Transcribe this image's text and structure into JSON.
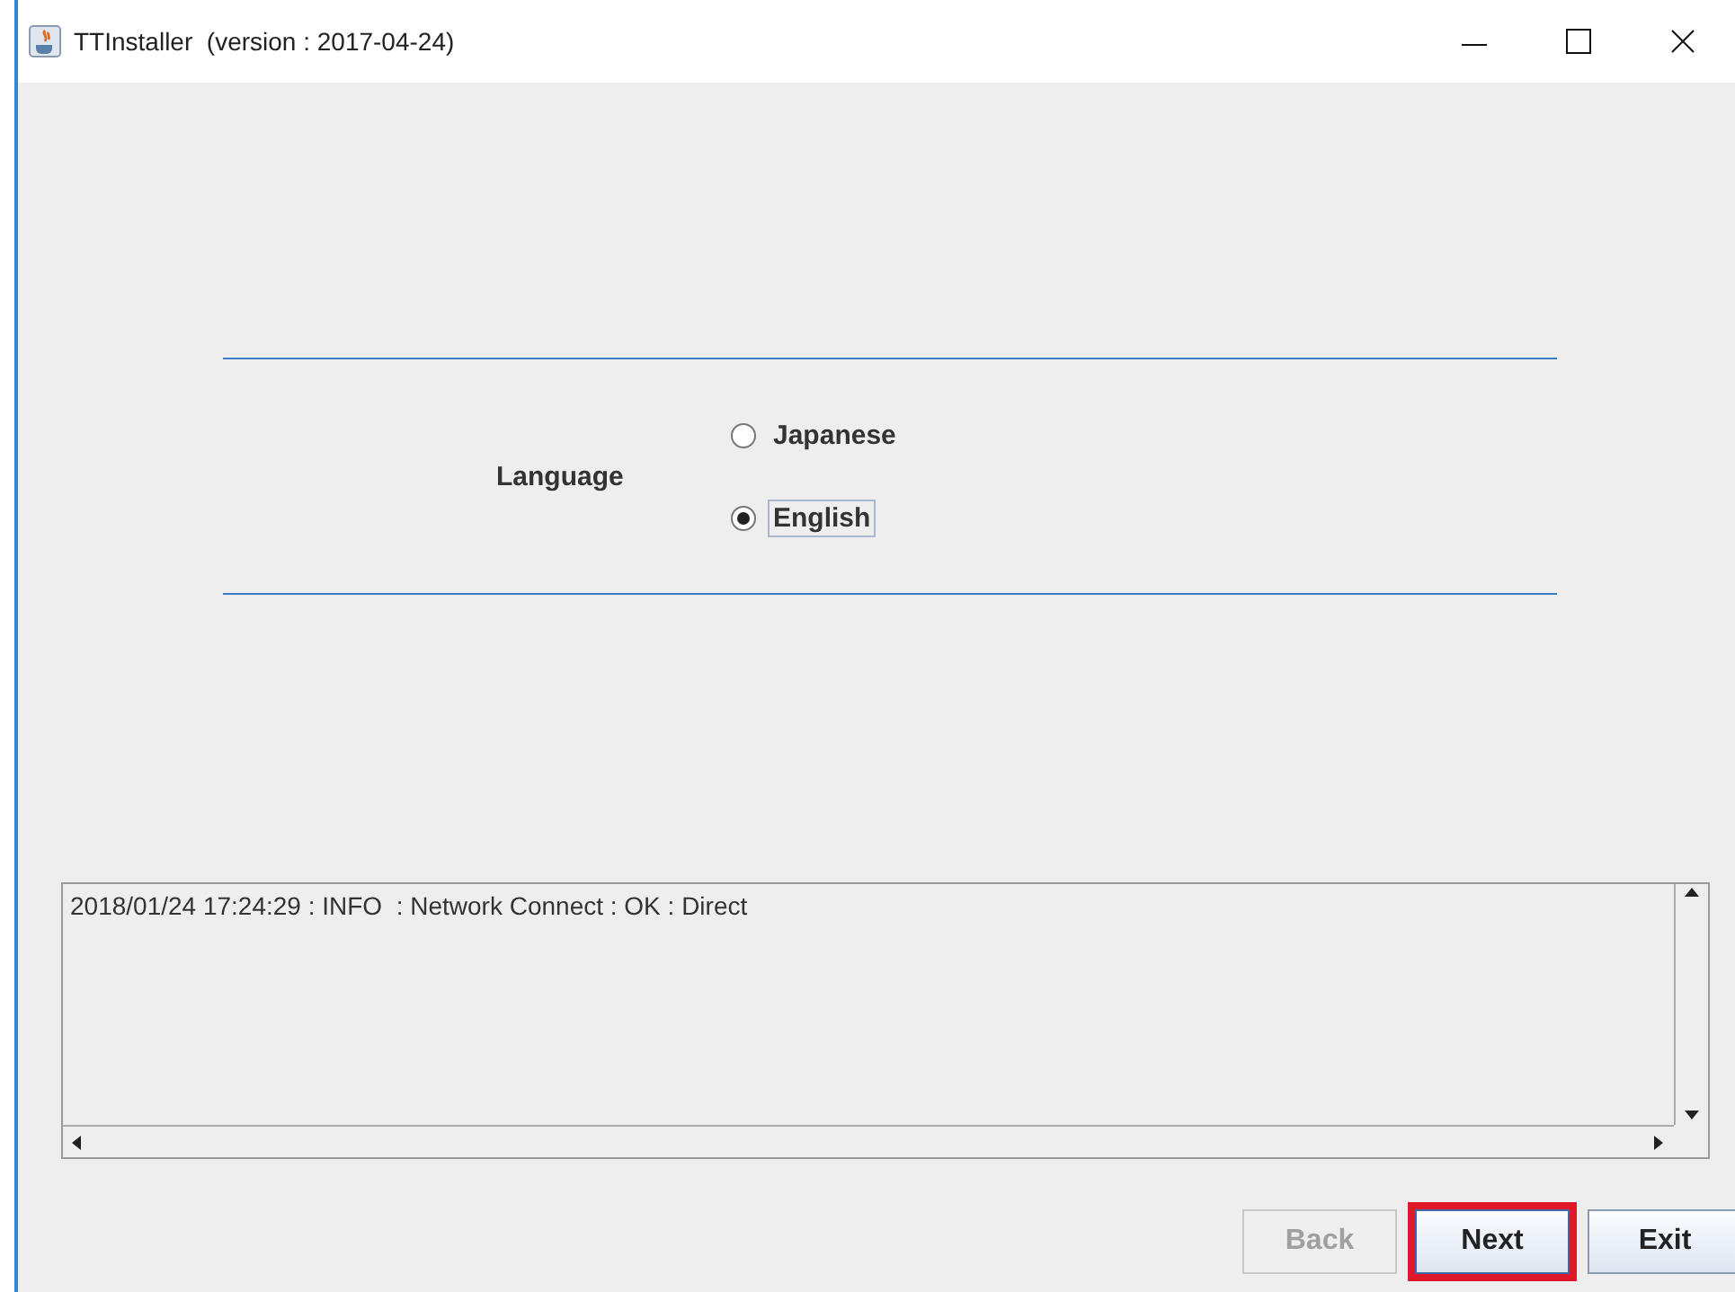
{
  "window": {
    "title": "TTInstaller  (version : 2017-04-24)"
  },
  "language": {
    "label": "Language",
    "options": [
      {
        "label": "Japanese",
        "selected": false
      },
      {
        "label": "English",
        "selected": true
      }
    ]
  },
  "log": {
    "lines": [
      "2018/01/24 17:24:29 : INFO  : Network Connect : OK : Direct"
    ]
  },
  "buttons": [
    {
      "label": "Back",
      "disabled": true,
      "highlighted": false
    },
    {
      "label": "Next",
      "disabled": false,
      "highlighted": true
    },
    {
      "label": "Exit",
      "disabled": false,
      "highlighted": false
    }
  ]
}
